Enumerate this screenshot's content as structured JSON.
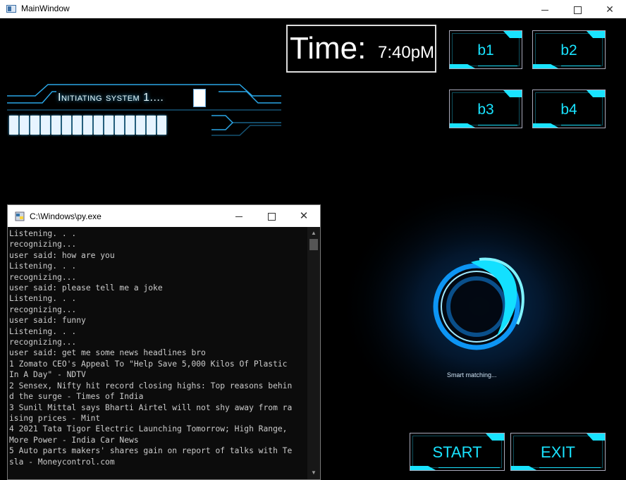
{
  "window": {
    "title": "MainWindow",
    "controls": {
      "minimize": "minimize",
      "maximize": "maximize",
      "close": "close"
    }
  },
  "time": {
    "label": "Time:",
    "value": "7:40pM"
  },
  "buttons": {
    "b1": "b1",
    "b2": "b2",
    "b3": "b3",
    "b4": "b4",
    "start": "START",
    "exit": "EXIT"
  },
  "loading": {
    "text": "Initiating system 1....",
    "segments": 15
  },
  "spinner": {
    "status_text": "Smart matching..."
  },
  "console": {
    "title": "C:\\Windows\\py.exe",
    "lines": [
      "Listening. . .",
      "recognizing...",
      "user said: how are you",
      "Listening. . .",
      "recognizing...",
      "user said: please tell me a joke",
      "Listening. . .",
      "recognizing...",
      "user said: funny",
      "Listening. . .",
      "recognizing...",
      "user said: get me some news headlines bro",
      "1 Zomato CEO's Appeal To \"Help Save 5,000 Kilos Of Plastic",
      "In A Day\" - NDTV",
      "2 Sensex, Nifty hit record closing highs: Top reasons behin",
      "d the surge - Times of India",
      "3 Sunil Mittal says Bharti Airtel will not shy away from ra",
      "ising prices - Mint",
      "4 2021 Tata Tigor Electric Launching Tomorrow; High Range,",
      "More Power - India Car News",
      "5 Auto parts makers' shares gain on report of talks with Te",
      "sla - Moneycontrol.com"
    ]
  },
  "colors": {
    "accent": "#19e3ff",
    "background": "#000000",
    "console_bg": "#0c0c0c",
    "console_text": "#cccccc"
  },
  "icons": [
    "app-window-icon",
    "python-console-icon",
    "spinner-ring-icon"
  ]
}
